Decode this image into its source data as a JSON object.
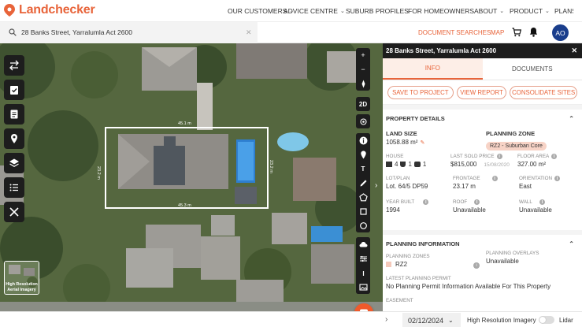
{
  "app": {
    "name": "Landchecker"
  },
  "nav": {
    "links": [
      {
        "label": "OUR CUSTOMERS",
        "has_menu": true
      },
      {
        "label": "ADVICE CENTRE",
        "has_menu": true
      },
      {
        "label": "SUBURB PROFILES",
        "has_menu": false
      },
      {
        "label": "FOR HOMEOWNERS",
        "has_menu": false
      },
      {
        "label": "ABOUT",
        "has_menu": true
      },
      {
        "label": "PRODUCT",
        "has_menu": true
      },
      {
        "label": "PLANS",
        "has_menu": false
      }
    ]
  },
  "search": {
    "value": "28 Banks Street, Yarralumla Act 2600",
    "clear": "✕"
  },
  "header_actions": {
    "document_searches": "DOCUMENT SEARCHES",
    "map": "MAP",
    "avatar_initials": "AO"
  },
  "map": {
    "dimensions": {
      "top": "45.1 m",
      "bottom": "45.3 m",
      "left": "23.2 m",
      "right": "23.2 m"
    },
    "layer_thumb_label_1": "High Resolution",
    "layer_thumb_label_2": "Aerial Imagery",
    "right_tools": {
      "zoom_in": "+",
      "zoom_out": "−",
      "mode_2d": "2D"
    }
  },
  "bottom_bar": {
    "date": "02/12/2024",
    "imagery_label": "High Resolution Imagery",
    "lidar_label": "Lidar",
    "lidar_enabled": false
  },
  "panel": {
    "title": "28 Banks Street, Yarralumla Act 2600",
    "close": "✕",
    "tabs": [
      {
        "label": "INFO",
        "active": true
      },
      {
        "label": "DOCUMENTS",
        "active": false
      }
    ],
    "actions": [
      "SAVE TO PROJECT",
      "VIEW REPORT",
      "CONSOLIDATE SITES"
    ],
    "property_details": {
      "heading": "PROPERTY DETAILS",
      "land_size_label": "LAND SIZE",
      "land_size_value": "1058.88 m²",
      "planning_zone_label": "PLANNING ZONE",
      "planning_zone_value": "RZ2 - Suburban Core",
      "house_label": "HOUSE",
      "bedrooms": "4",
      "bathrooms": "1",
      "car_spaces": "1",
      "last_sold_label": "LAST SOLD PRICE",
      "last_sold_value": "$815,000",
      "last_sold_date": "15/08/2020",
      "floor_area_label": "FLOOR AREA",
      "floor_area_value": "327.00 m²",
      "lot_plan_label": "LOT/PLAN",
      "lot_plan_value": "Lot. 64/5 DP59",
      "frontage_label": "FRONTAGE",
      "frontage_value": "23.17 m",
      "orientation_label": "ORIENTATION",
      "orientation_value": "East",
      "year_built_label": "YEAR BUILT",
      "year_built_value": "1994",
      "roof_label": "ROOF",
      "roof_value": "Unavailable",
      "wall_label": "WALL",
      "wall_value": "Unavailable"
    },
    "planning_information": {
      "heading": "PLANNING INFORMATION",
      "zones_label": "PLANNING ZONES",
      "zones_value": "RZ2",
      "overlays_label": "PLANNING OVERLAYS",
      "overlays_value": "Unavailable",
      "permit_label": "LATEST PLANNING PERMIT",
      "permit_value": "No Planning Permit Information Available For This Property",
      "easement_label": "EASEMENT"
    }
  },
  "colors": {
    "brand": "#e8643a",
    "dark_tool": "#1d1d1d",
    "zone_pill": "#f7d3c6",
    "avatar": "#1a3e8c"
  }
}
